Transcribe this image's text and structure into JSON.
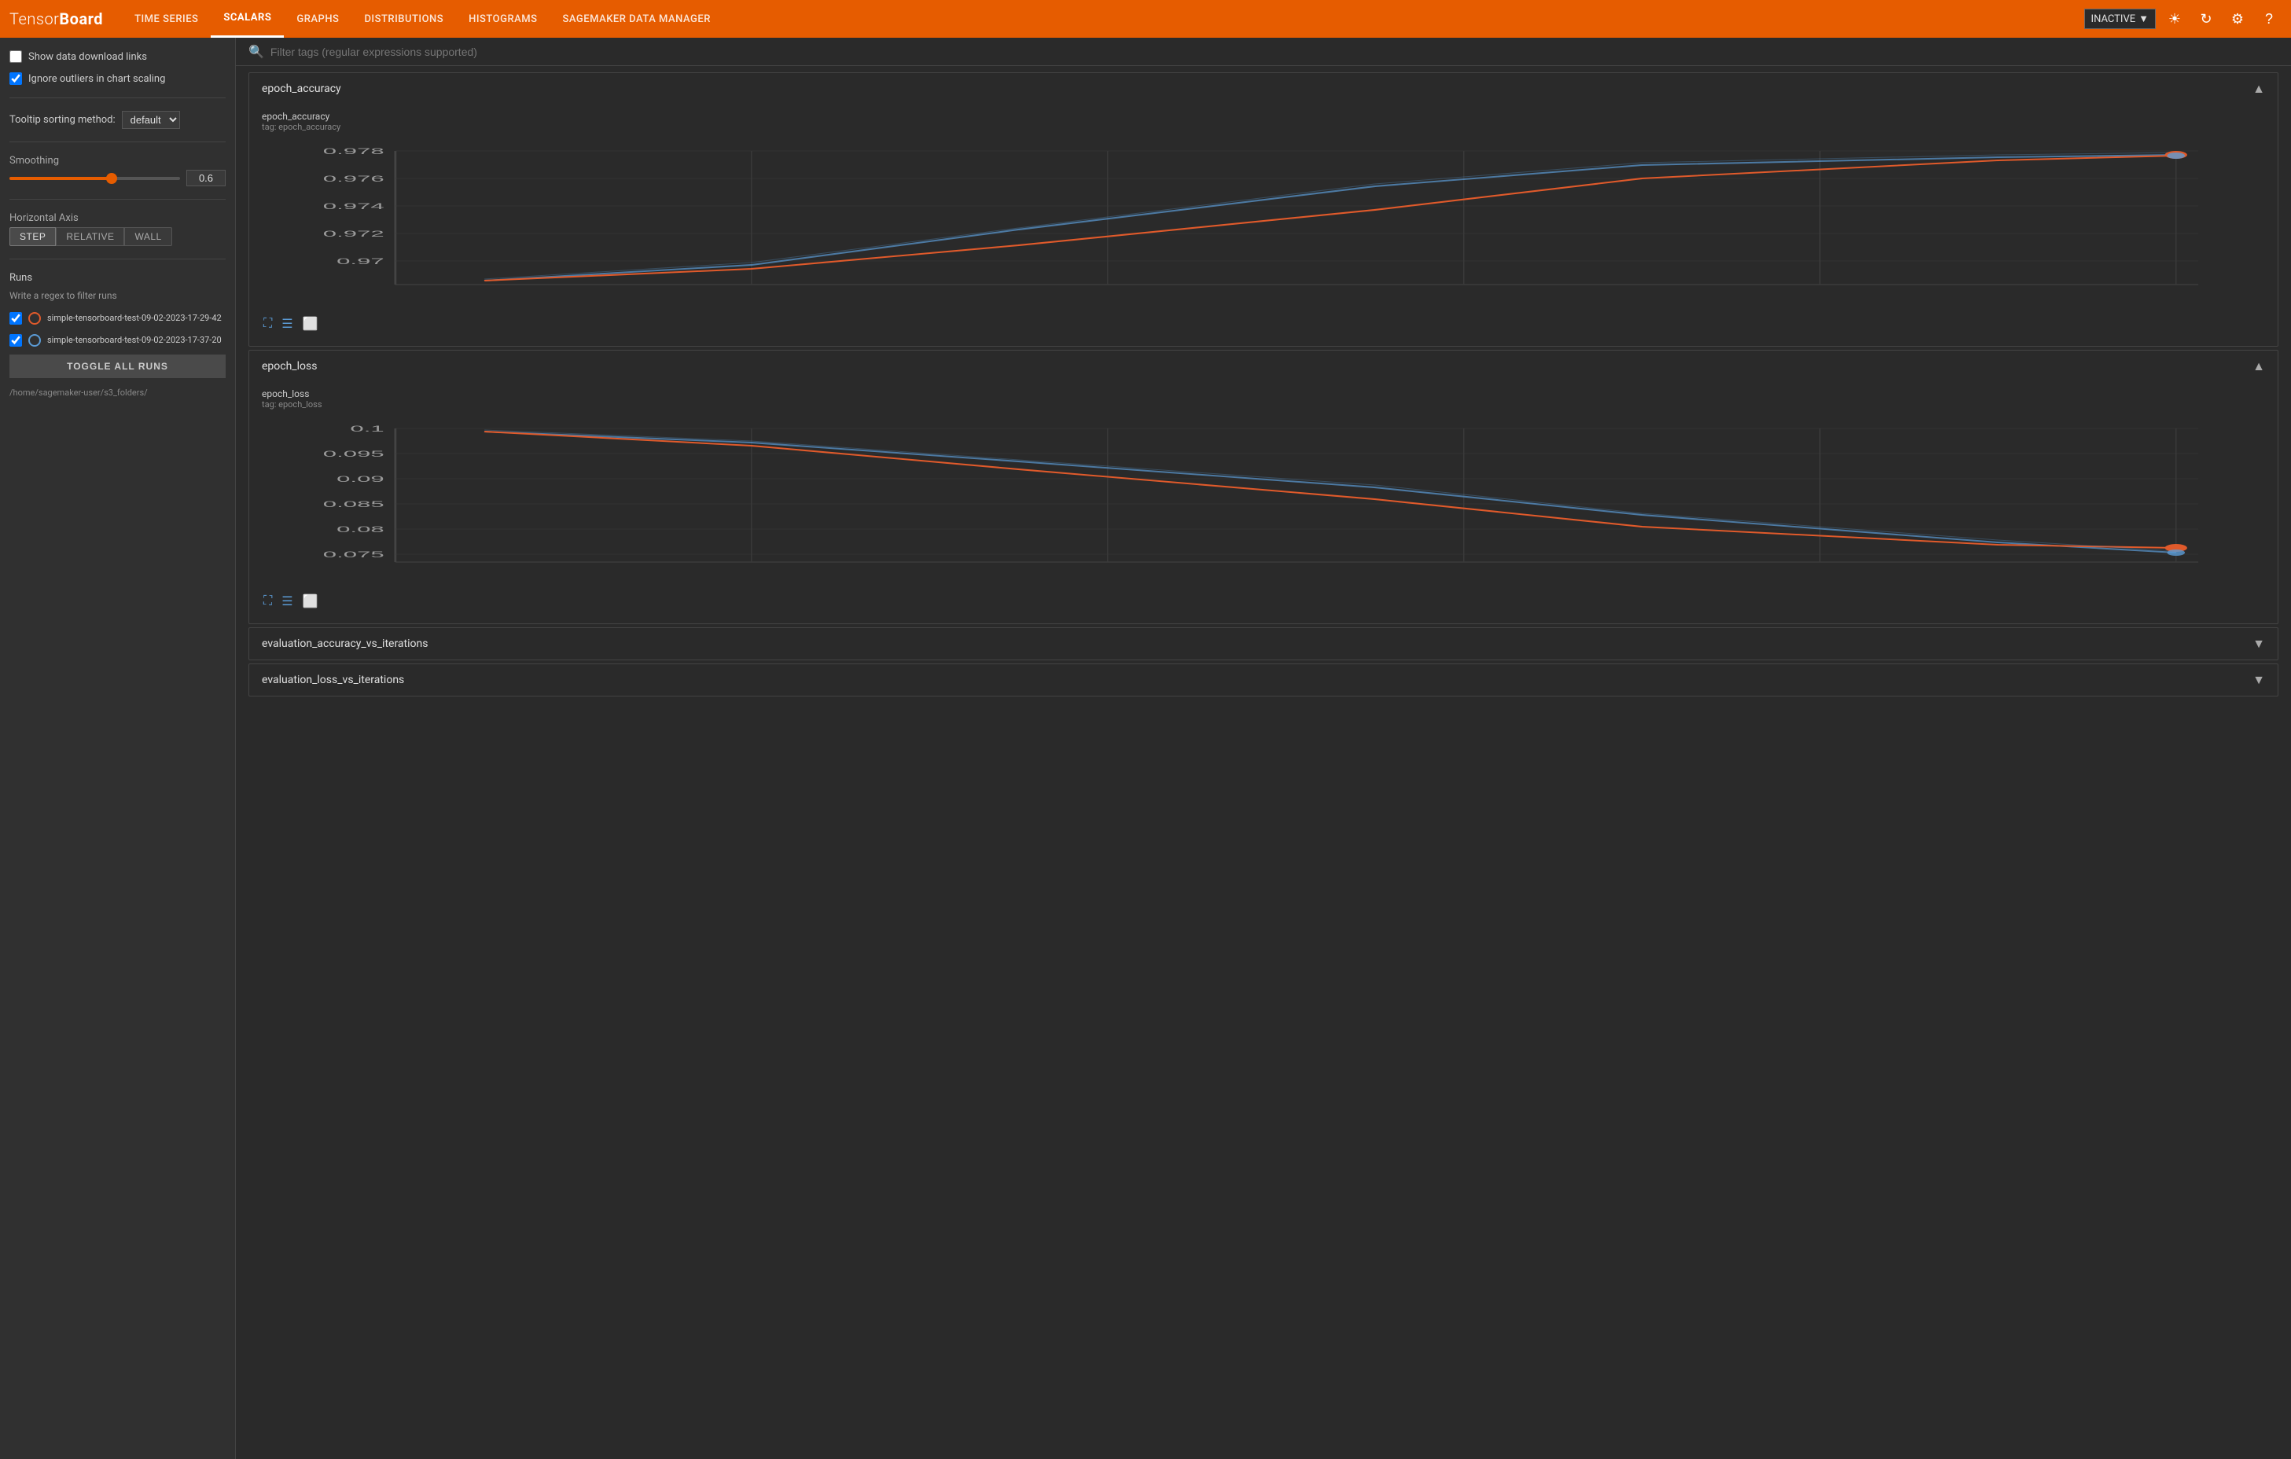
{
  "app": {
    "name": "TensorBoard",
    "name_bold": "Board"
  },
  "nav": {
    "items": [
      {
        "id": "time-series",
        "label": "TIME SERIES",
        "active": false
      },
      {
        "id": "scalars",
        "label": "SCALARS",
        "active": true
      },
      {
        "id": "graphs",
        "label": "GRAPHS",
        "active": false
      },
      {
        "id": "distributions",
        "label": "DISTRIBUTIONS",
        "active": false
      },
      {
        "id": "histograms",
        "label": "HISTOGRAMS",
        "active": false
      },
      {
        "id": "sagemaker",
        "label": "SAGEMAKER DATA MANAGER",
        "active": false
      }
    ],
    "status": "INACTIVE"
  },
  "sidebar": {
    "show_download": "Show data download links",
    "ignore_outliers": "Ignore outliers in chart scaling",
    "tooltip_label": "Tooltip sorting method:",
    "tooltip_value": "default",
    "smoothing_label": "Smoothing",
    "smoothing_value": "0.6",
    "axis_label": "Horizontal Axis",
    "axis_buttons": [
      "STEP",
      "RELATIVE",
      "WALL"
    ],
    "axis_active": "STEP",
    "runs_label": "Runs",
    "runs_filter": "Write a regex to filter runs",
    "runs": [
      {
        "name": "simple-tensorboard-test-09-02-2023-17-29-42",
        "color": "#e05a2b",
        "checked": true,
        "dot_style": "orange"
      },
      {
        "name": "simple-tensorboard-test-09-02-2023-17-37-20",
        "color": "#5b9bd5",
        "checked": true,
        "dot_style": "blue"
      }
    ],
    "toggle_all_label": "TOGGLE ALL RUNS",
    "folder_path": "/home/sagemaker-user/s3_folders/"
  },
  "filter": {
    "placeholder": "Filter tags (regular expressions supported)"
  },
  "charts": [
    {
      "id": "epoch_accuracy",
      "title": "epoch_accuracy",
      "collapsed": false,
      "chart_title": "epoch_accuracy",
      "chart_subtitle": "tag: epoch_accuracy",
      "y_values": [
        "0.978",
        "0.976",
        "0.974",
        "0.972",
        "0.970"
      ],
      "type": "accuracy"
    },
    {
      "id": "epoch_loss",
      "title": "epoch_loss",
      "collapsed": false,
      "chart_title": "epoch_loss",
      "chart_subtitle": "tag: epoch_loss",
      "y_values": [
        "0.1",
        "0.095",
        "0.09",
        "0.085",
        "0.08",
        "0.075"
      ],
      "type": "loss"
    },
    {
      "id": "eval_accuracy",
      "title": "evaluation_accuracy_vs_iterations",
      "collapsed": true
    },
    {
      "id": "eval_loss",
      "title": "evaluation_loss_vs_iterations",
      "collapsed": true
    }
  ]
}
